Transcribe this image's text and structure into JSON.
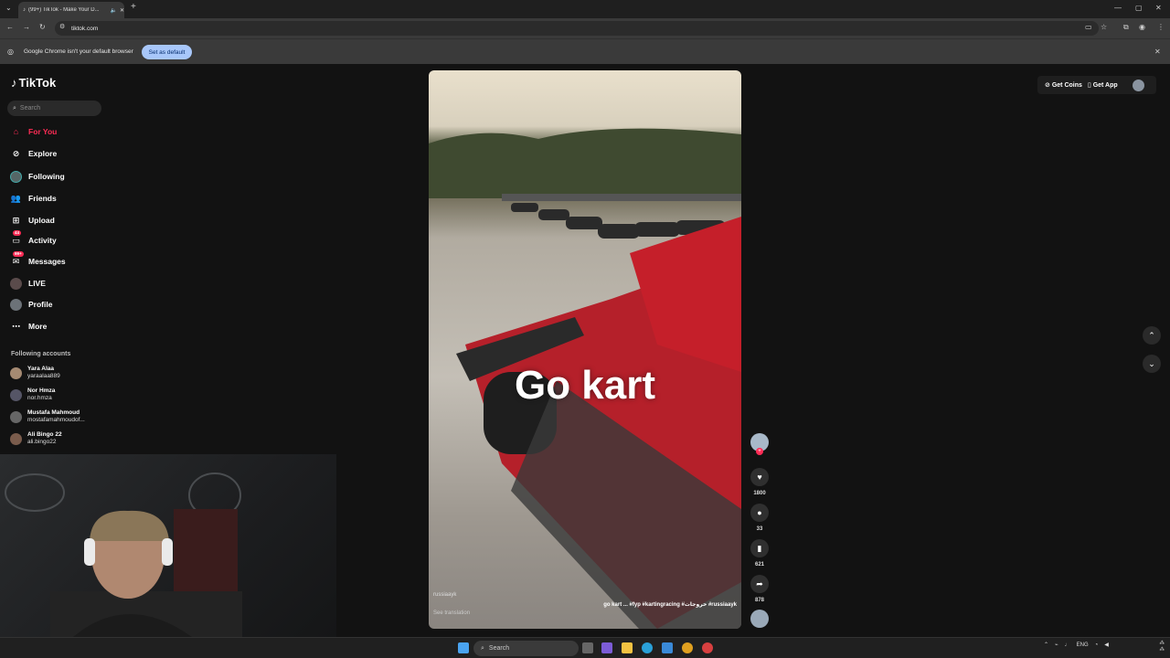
{
  "browser": {
    "tab_title": "(99+) TikTok - Make Your D...",
    "url": "tiktok.com",
    "infobar_text": "Google Chrome isn't your default browser",
    "set_default_label": "Set as default"
  },
  "sidebar": {
    "logo": "TikTok",
    "search_placeholder": "Search",
    "nav": [
      {
        "label": "For You",
        "icon": "home-icon",
        "active": true
      },
      {
        "label": "Explore",
        "icon": "compass-icon"
      },
      {
        "label": "Following",
        "icon": "following-icon"
      },
      {
        "label": "Friends",
        "icon": "friends-icon"
      },
      {
        "label": "Upload",
        "icon": "upload-icon"
      },
      {
        "label": "Activity",
        "icon": "inbox-icon",
        "badge": "44"
      },
      {
        "label": "Messages",
        "icon": "message-icon",
        "badge": "99+"
      },
      {
        "label": "LIVE",
        "icon": "live-icon"
      },
      {
        "label": "Profile",
        "icon": "profile-icon"
      },
      {
        "label": "More",
        "icon": "more-icon"
      }
    ],
    "following_header": "Following accounts",
    "accounts": [
      {
        "name": "Yara Alaa",
        "user": "yaraalaa889"
      },
      {
        "name": "Nor Hmza",
        "user": "nor.hmza"
      },
      {
        "name": "Mustafa Mahmoud",
        "user": "mostafamahmoudof..."
      },
      {
        "name": "Ali Bingo 22",
        "user": "ali.bingo22"
      }
    ]
  },
  "video": {
    "caption": "Go kart",
    "author": "russiaayk",
    "description": "go kart ... #fyp #kartingracing #خروجات #russiaayk",
    "see_translation": "See translation"
  },
  "actions": {
    "likes": "1800",
    "comments": "33",
    "saves": "621",
    "shares": "878"
  },
  "topbar": {
    "get_coins": "Get Coins",
    "get_app": "Get App"
  },
  "taskbar": {
    "search": "Search",
    "lang": "ENG"
  },
  "colors": {
    "accent": "#fe2c55",
    "background": "#121212"
  }
}
